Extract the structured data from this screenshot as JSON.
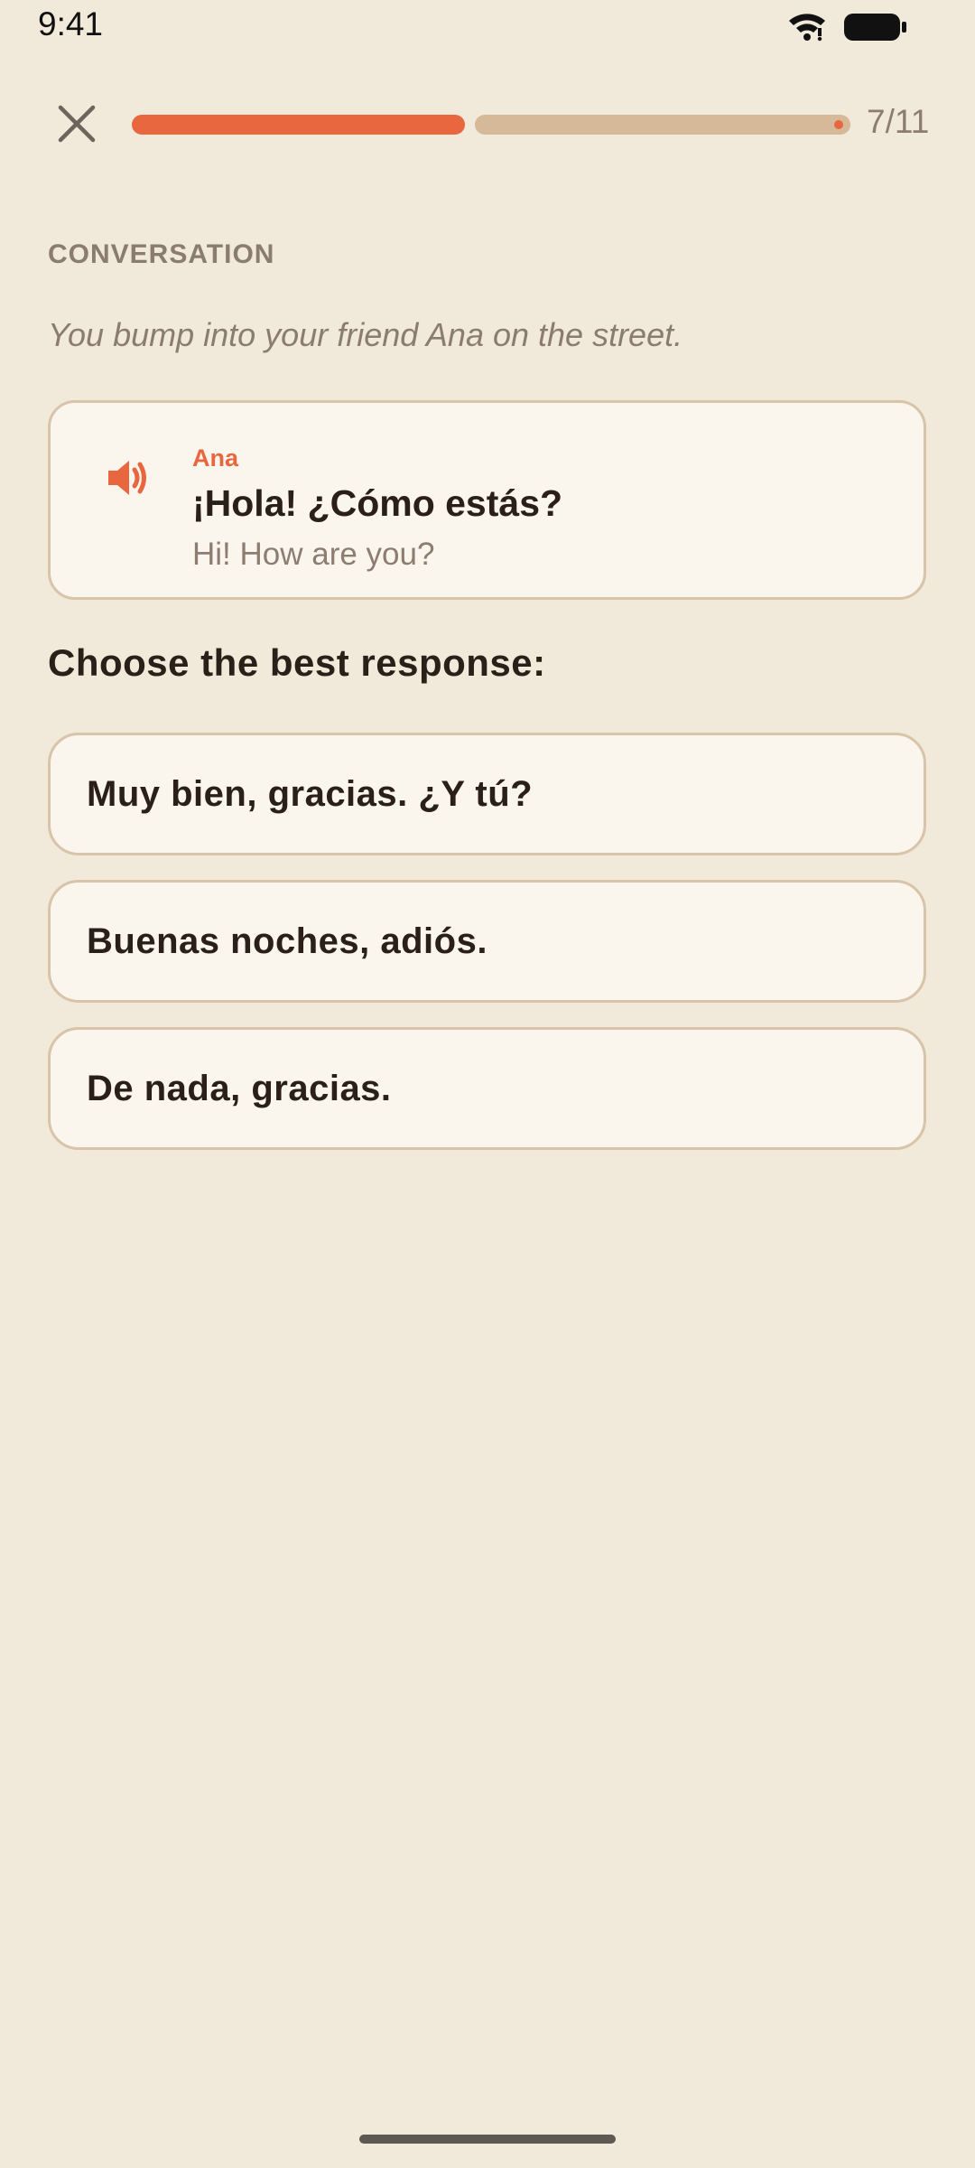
{
  "status_bar": {
    "time": "9:41",
    "icons": [
      "wifi-icon",
      "battery-icon"
    ]
  },
  "header": {
    "close_icon": "close-icon",
    "progress_current": 7,
    "progress_total": 11,
    "progress_fraction": 0.4636,
    "progress_label": "7/11",
    "progress_color": "#E8673F",
    "track_color": "#D5B998"
  },
  "exercise": {
    "section_label": "CONVERSATION",
    "scenario": "You bump into your friend Ana on the street.",
    "dialogue": {
      "icon": "speaker-icon",
      "speaker": "Ana",
      "line": "¡Hola! ¿Cómo estás?",
      "translation": "Hi! How are you?"
    },
    "prompt": "Choose the best response:",
    "options": [
      {
        "label": "Muy bien, gracias. ¿Y tú?"
      },
      {
        "label": "Buenas noches, adiós."
      },
      {
        "label": "De nada, gracias."
      }
    ]
  },
  "colors": {
    "background": "#F1E9DA",
    "card": "#FAF6EE",
    "border": "#D8C4A9",
    "accent": "#E8673F",
    "text": "#2B1F1A",
    "muted": "#8A7C6F"
  }
}
